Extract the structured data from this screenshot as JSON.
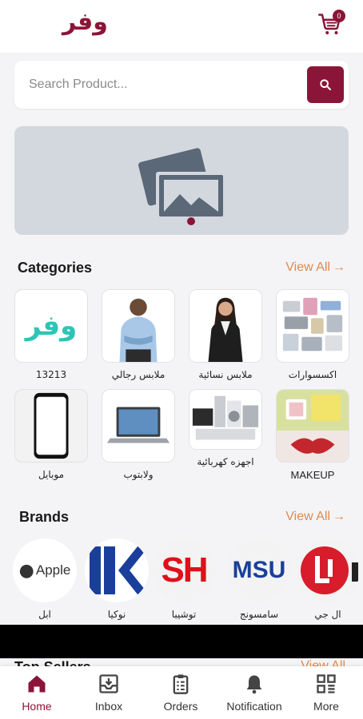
{
  "header": {
    "logo": "وفر",
    "cart_count": "0"
  },
  "search": {
    "placeholder": "Search Product..."
  },
  "categories": {
    "title": "Categories",
    "view_all": "View All",
    "items": [
      {
        "label": "13213",
        "image": "wafr-logo"
      },
      {
        "label": "ملابس رجالي",
        "image": "man-photo"
      },
      {
        "label": "ملابس نسائية",
        "image": "woman-photo"
      },
      {
        "label": "اكسسوارات",
        "image": "accessories-photo"
      },
      {
        "label": "موبايل",
        "image": "mobile-photo"
      },
      {
        "label": "ولابتوب",
        "image": "laptop-photo"
      },
      {
        "label": "اجهزه كهربائية",
        "image": "appliances-photo"
      },
      {
        "label": "MAKEUP",
        "image": "makeup-photo"
      }
    ]
  },
  "brands": {
    "title": "Brands",
    "view_all": "View All",
    "items": [
      {
        "label": "ابل",
        "logo_text": "Apple"
      },
      {
        "label": "نوكيا",
        "logo_text": ""
      },
      {
        "label": "توشيبا",
        "logo_text": "SH"
      },
      {
        "label": "سامسونج",
        "logo_text": "MSU"
      },
      {
        "label": "ال جي",
        "logo_text": "L"
      }
    ]
  },
  "next_section": {
    "title": "Top Sellers",
    "view_all": "View All"
  },
  "bottom_nav": {
    "items": [
      {
        "label": "Home",
        "icon": "home-icon",
        "active": true
      },
      {
        "label": "Inbox",
        "icon": "inbox-icon"
      },
      {
        "label": "Orders",
        "icon": "orders-icon"
      },
      {
        "label": "Notification",
        "icon": "bell-icon"
      },
      {
        "label": "More",
        "icon": "grid-icon"
      }
    ]
  },
  "colors": {
    "brand": "#8b1538",
    "accent": "#e08a4a",
    "logo_teal": "#2ec4b6"
  }
}
